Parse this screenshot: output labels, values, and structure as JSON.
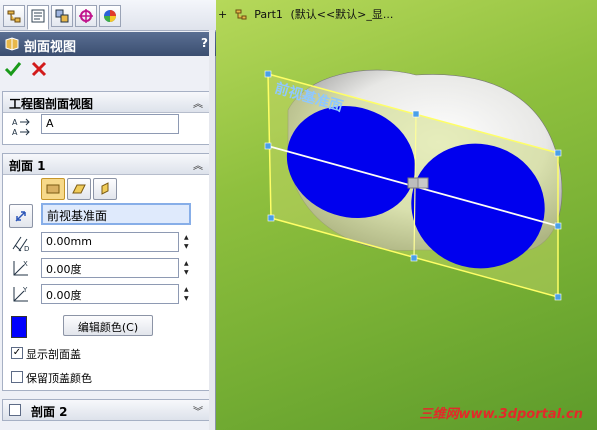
{
  "tree": {
    "expand": "+",
    "part": "Part1",
    "config": "(默认<<默认>_显..."
  },
  "panel": {
    "title": "剖面视图",
    "help": "?",
    "tabs": [
      "feature-manager",
      "property-manager",
      "configuration-manager",
      "dimxpert-manager",
      "display-manager"
    ],
    "group1": {
      "title": "工程图剖面视图",
      "label_value": "A"
    },
    "group2": {
      "title": "剖面 1",
      "plane": "前视基准面",
      "distance": "0.00mm",
      "angle_x": "0.00度",
      "angle_y": "0.00度",
      "edit_color_btn": "编辑颜色(C)",
      "section_color": "#0000ff",
      "show_cap": "显示剖面盖",
      "show_cap_checked": true,
      "keep_top_color": "保留顶盖颜色",
      "keep_top_color_checked": false
    },
    "group3": {
      "title": "剖面 2"
    }
  },
  "viewport": {
    "plane_label": "前视基准面",
    "section_fill": "#0000ee",
    "plane_color": "#ffff66"
  },
  "watermark": "三维网www.3dportal.cn"
}
